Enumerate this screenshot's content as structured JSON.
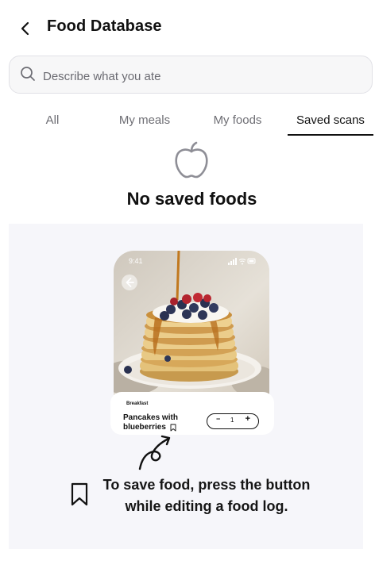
{
  "header": {
    "title": "Food Database",
    "back_icon": "chevron-left-icon"
  },
  "search": {
    "placeholder": "Describe what you ate",
    "value": "",
    "icon": "search-icon"
  },
  "tabs": [
    {
      "label": "All",
      "active": false
    },
    {
      "label": "My meals",
      "active": false
    },
    {
      "label": "My foods",
      "active": false
    },
    {
      "label": "Saved scans",
      "active": true
    }
  ],
  "empty_state": {
    "icon": "apple-icon",
    "title": "No saved foods"
  },
  "illustration": {
    "status_time": "9:41",
    "meal_tag": "Breakfast",
    "food_name": "Pancakes with blueberries",
    "quantity": "1",
    "minus": "−",
    "plus": "+"
  },
  "hint": {
    "icon": "bookmark-icon",
    "text": "To save food, press the button while editing a food log."
  },
  "colors": {
    "panel_bg": "#f6f6fa",
    "active_tab_underline": "#111111",
    "muted_text": "#6e6e74"
  }
}
